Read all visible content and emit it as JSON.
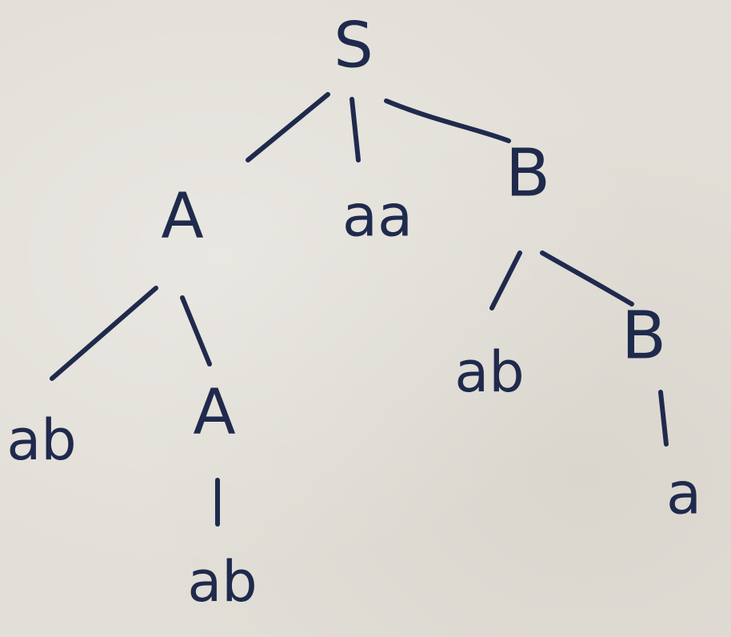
{
  "tree": {
    "nodes": {
      "root": "S",
      "child_A": "A",
      "child_aa": "aa",
      "child_B": "B",
      "leaf_A_ab": "ab",
      "inner_A": "A",
      "inner_A_ab": "ab",
      "leaf_B_ab": "ab",
      "inner_B": "B",
      "inner_B_a": "a"
    }
  }
}
